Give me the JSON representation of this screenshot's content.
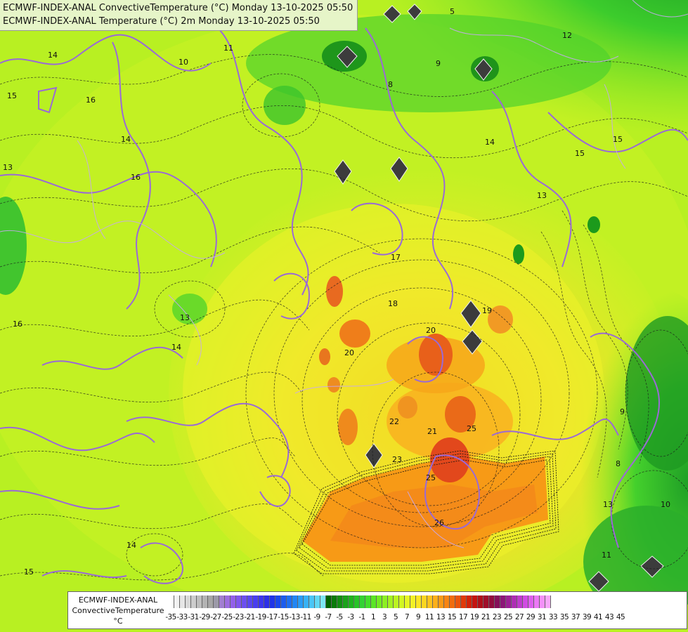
{
  "title_lines": [
    "ECMWF-INDEX-ANAL ConvectiveTemperature (°C) Monday 13-10-2025 05:50",
    "ECMWF-INDEX-ANAL Temperature (°C) 2m Monday 13-10-2025 05:50"
  ],
  "legend": {
    "caption_lines": [
      "ECMWF-INDEX-ANAL",
      "ConvectiveTemperature",
      "°C"
    ],
    "tick_labels": [
      "-35",
      "-33",
      "-31",
      "-29",
      "-27",
      "-25",
      "-23",
      "-21",
      "-19",
      "-17",
      "-15",
      "-13",
      "-11",
      "-9",
      "-7",
      "-5",
      "-3",
      "-1",
      "1",
      "3",
      "5",
      "7",
      "9",
      "11",
      "13",
      "15",
      "17",
      "19",
      "21",
      "23",
      "25",
      "27",
      "29",
      "31",
      "33",
      "35",
      "37",
      "39",
      "41",
      "43",
      "45"
    ],
    "swatches": [
      "#ffffff",
      "#f2f2f2",
      "#e6e6e6",
      "#d9d9d9",
      "#cccccc",
      "#bfbfbf",
      "#b3b3b3",
      "#a6a6a6",
      "#9c9aa8",
      "#a27fd0",
      "#9e6ee0",
      "#9360ea",
      "#8056ee",
      "#6c50f0",
      "#5a48f0",
      "#4a3ff0",
      "#3d36ee",
      "#2d2ee8",
      "#1f34e8",
      "#1a48ea",
      "#1c5cee",
      "#1e70f2",
      "#2286f4",
      "#2a9cf6",
      "#38b2f6",
      "#4ac6f6",
      "#60d8f4",
      "#7ee6f4",
      "#006400",
      "#0a7a0a",
      "#138e13",
      "#1aa21a",
      "#20b420",
      "#28c428",
      "#34d234",
      "#44de2c",
      "#5ae626",
      "#72ec22",
      "#8cf022",
      "#a4f222",
      "#bcf422",
      "#d2f622",
      "#e6f624",
      "#f4f226",
      "#fae624",
      "#fcd622",
      "#fcc41e",
      "#fcb01a",
      "#fa9a16",
      "#f68412",
      "#f06c0e",
      "#ea540c",
      "#e03a0a",
      "#d42208",
      "#c41410",
      "#b0101a",
      "#a00e2a",
      "#920e3e",
      "#86105a",
      "#8c1678",
      "#9c2096",
      "#ae2eb4",
      "#c03cce",
      "#d04ce2",
      "#de60ee",
      "#ec78f6",
      "#f492fa",
      "#f8a8fc"
    ]
  },
  "contour_labels": [
    {
      "t": "14"
    },
    {
      "t": "15"
    },
    {
      "t": "16"
    },
    {
      "t": "13"
    },
    {
      "t": "14"
    },
    {
      "t": "16"
    },
    {
      "t": "10"
    },
    {
      "t": "11"
    },
    {
      "t": "16"
    },
    {
      "t": "13"
    },
    {
      "t": "14"
    },
    {
      "t": "17"
    },
    {
      "t": "18"
    },
    {
      "t": "19"
    },
    {
      "t": "20"
    },
    {
      "t": "20"
    },
    {
      "t": "22"
    },
    {
      "t": "21"
    },
    {
      "t": "23"
    },
    {
      "t": "25"
    },
    {
      "t": "25"
    },
    {
      "t": "26"
    },
    {
      "t": "14"
    },
    {
      "t": "15"
    },
    {
      "t": "5"
    },
    {
      "t": "8"
    },
    {
      "t": "9"
    },
    {
      "t": "12"
    },
    {
      "t": "14"
    },
    {
      "t": "15"
    },
    {
      "t": "13"
    },
    {
      "t": "9"
    },
    {
      "t": "8"
    },
    {
      "t": "10"
    },
    {
      "t": "11"
    },
    {
      "t": "13"
    },
    {
      "t": "15"
    }
  ]
}
